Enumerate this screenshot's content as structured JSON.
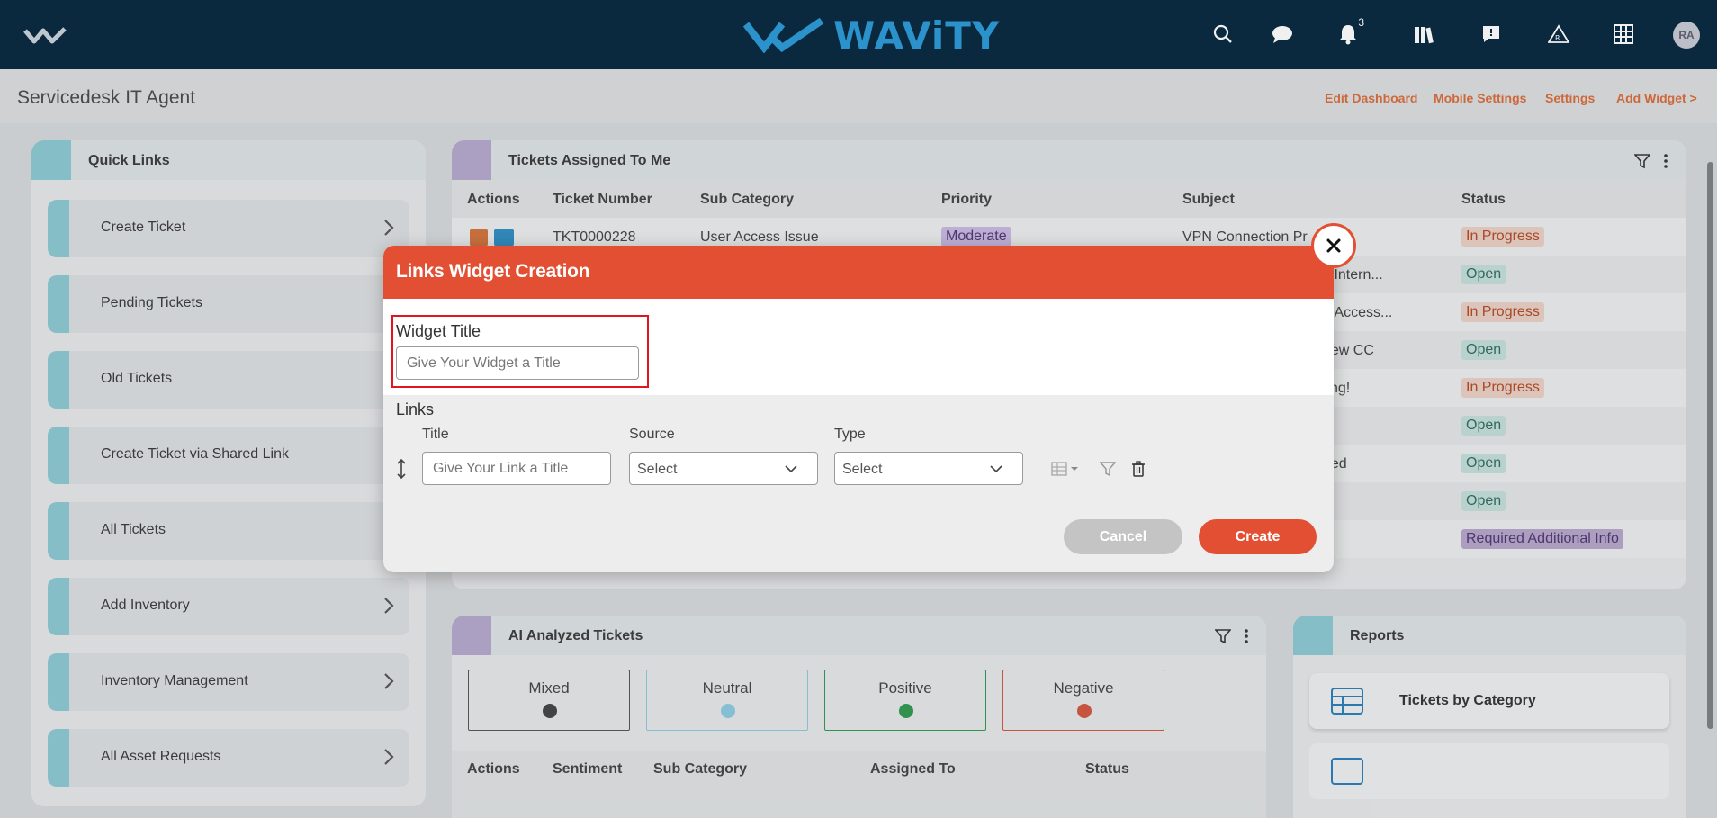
{
  "topbar": {
    "brand": "WAViTY",
    "notification_count": "3",
    "avatar_initials": "RA",
    "icons": [
      "search-icon",
      "chat-icon",
      "bell-icon",
      "library-icon",
      "feedback-icon",
      "warning-icon",
      "grid-icon"
    ]
  },
  "header": {
    "page_title": "Servicedesk IT Agent",
    "links": [
      "Edit Dashboard",
      "Mobile Settings",
      "Settings",
      "Add Widget >"
    ]
  },
  "quick_links": {
    "title": "Quick Links",
    "items": [
      {
        "label": "Create Ticket",
        "chevron": true
      },
      {
        "label": "Pending Tickets",
        "chevron": false
      },
      {
        "label": "Old Tickets",
        "chevron": false
      },
      {
        "label": "Create Ticket via Shared Link",
        "chevron": false
      },
      {
        "label": "All Tickets",
        "chevron": false
      },
      {
        "label": "Add Inventory",
        "chevron": true
      },
      {
        "label": "Inventory Management",
        "chevron": true
      },
      {
        "label": "All Asset Requests",
        "chevron": true
      }
    ]
  },
  "tickets": {
    "title": "Tickets Assigned To Me",
    "columns": [
      "Actions",
      "Ticket Number",
      "Sub Category",
      "Priority",
      "Subject",
      "Status"
    ],
    "first_row": {
      "ticket": "TKT0000228",
      "sub_category": "User Access Issue",
      "priority": "Moderate",
      "subject": "VPN Connection Pr"
    },
    "subject_fragments": [
      "",
      "it Intern...",
      "g Access...",
      "new CC",
      "ting!",
      "",
      "ded",
      "",
      ""
    ],
    "statuses": [
      "In Progress",
      "Open",
      "In Progress",
      "Open",
      "In Progress",
      "Open",
      "Open",
      "Open",
      "Required Additional Info"
    ]
  },
  "ai_tickets": {
    "title": "AI Analyzed Tickets",
    "sentiments": [
      "Mixed",
      "Neutral",
      "Positive",
      "Negative"
    ],
    "columns": [
      "Actions",
      "Sentiment",
      "Sub Category",
      "Assigned To",
      "Status"
    ]
  },
  "reports": {
    "title": "Reports",
    "items": [
      "Tickets by Category"
    ]
  },
  "modal": {
    "title": "Links Widget Creation",
    "widget_title_label": "Widget Title",
    "widget_title_placeholder": "Give Your Widget a Title",
    "links_label": "Links",
    "col_title": "Title",
    "col_source": "Source",
    "col_type": "Type",
    "link_title_placeholder": "Give Your Link a Title",
    "source_value": "Select",
    "type_value": "Select",
    "cancel_label": "Cancel",
    "create_label": "Create"
  },
  "colors": {
    "topbar": "#06273d",
    "brand": "#2a9ad6",
    "accent": "#e24f32",
    "link": "#d96c39"
  }
}
